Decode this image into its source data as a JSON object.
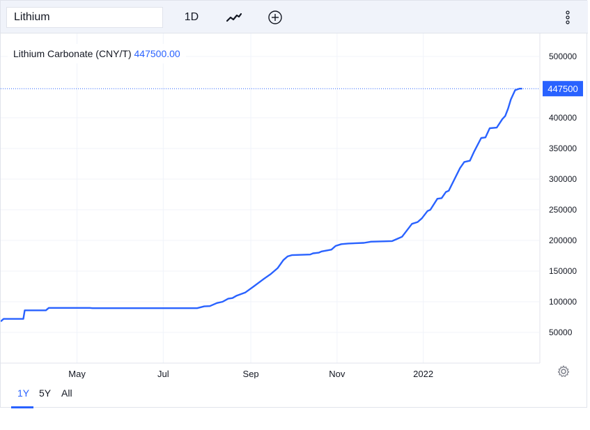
{
  "toolbar": {
    "search_value": "Lithium",
    "interval_label": "1D",
    "chart_style_icon": "line-chart-icon",
    "compare_icon": "plus-circle-icon",
    "more_icon": "vertical-dots-icon"
  },
  "legend": {
    "symbol": "Lithium Carbonate (CNY/T)",
    "value": "447500.00"
  },
  "range_tabs": [
    {
      "label": "1Y",
      "active": true
    },
    {
      "label": "5Y",
      "active": false
    },
    {
      "label": "All",
      "active": false
    }
  ],
  "settings_icon": "gear-icon",
  "colors": {
    "line": "#2962ff",
    "grid": "#f0f3fa",
    "price_label_bg": "#2962ff"
  },
  "chart_data": {
    "type": "line",
    "title": "Lithium Carbonate (CNY/T)",
    "last_value": 447500,
    "y_ticks": [
      50000,
      100000,
      150000,
      200000,
      250000,
      300000,
      350000,
      400000,
      500000
    ],
    "x_ticks": [
      "May",
      "Jul",
      "Sep",
      "Nov",
      "2022"
    ],
    "ylim": [
      0,
      537500
    ],
    "x_range": [
      "2021-03-08",
      "2022-03-24"
    ],
    "grid": true,
    "series": [
      {
        "values": [
          [
            "2021-03-08",
            68000
          ],
          [
            "2021-03-10",
            72000
          ],
          [
            "2021-03-24",
            72000
          ],
          [
            "2021-03-25",
            86000
          ],
          [
            "2021-04-09",
            86000
          ],
          [
            "2021-04-11",
            90000
          ],
          [
            "2021-05-10",
            90000
          ],
          [
            "2021-05-12",
            89500
          ],
          [
            "2021-07-25",
            89500
          ],
          [
            "2021-07-30",
            92500
          ],
          [
            "2021-08-03",
            93000
          ],
          [
            "2021-08-08",
            98000
          ],
          [
            "2021-08-12",
            100000
          ],
          [
            "2021-08-16",
            105000
          ],
          [
            "2021-08-19",
            106000
          ],
          [
            "2021-08-22",
            110000
          ],
          [
            "2021-08-28",
            115000
          ],
          [
            "2021-09-03",
            125000
          ],
          [
            "2021-09-10",
            137000
          ],
          [
            "2021-09-15",
            145000
          ],
          [
            "2021-09-20",
            155000
          ],
          [
            "2021-09-24",
            168000
          ],
          [
            "2021-09-27",
            174000
          ],
          [
            "2021-09-30",
            176000
          ],
          [
            "2021-10-13",
            177000
          ],
          [
            "2021-10-15",
            179000
          ],
          [
            "2021-10-19",
            180000
          ],
          [
            "2021-10-21",
            182000
          ],
          [
            "2021-10-28",
            185000
          ],
          [
            "2021-10-31",
            191000
          ],
          [
            "2021-11-04",
            194000
          ],
          [
            "2021-11-09",
            195000
          ],
          [
            "2021-11-20",
            196000
          ],
          [
            "2021-11-25",
            198000
          ],
          [
            "2021-12-10",
            199000
          ],
          [
            "2021-12-14",
            203000
          ],
          [
            "2021-12-17",
            206000
          ],
          [
            "2021-12-24",
            227000
          ],
          [
            "2021-12-28",
            230000
          ],
          [
            "2021-12-31",
            236000
          ],
          [
            "2022-01-04",
            248000
          ],
          [
            "2022-01-06",
            250000
          ],
          [
            "2022-01-11",
            268000
          ],
          [
            "2022-01-14",
            269000
          ],
          [
            "2022-01-17",
            279000
          ],
          [
            "2022-01-19",
            281000
          ],
          [
            "2022-01-27",
            318000
          ],
          [
            "2022-01-30",
            328000
          ],
          [
            "2022-02-03",
            330000
          ],
          [
            "2022-02-06",
            345000
          ],
          [
            "2022-02-11",
            367000
          ],
          [
            "2022-02-14",
            368000
          ],
          [
            "2022-02-17",
            383000
          ],
          [
            "2022-02-22",
            384000
          ],
          [
            "2022-02-26",
            398000
          ],
          [
            "2022-02-28",
            403000
          ],
          [
            "2022-03-02",
            415000
          ],
          [
            "2022-03-04",
            430000
          ],
          [
            "2022-03-07",
            445000
          ],
          [
            "2022-03-10",
            447500
          ],
          [
            "2022-03-12",
            447500
          ]
        ]
      }
    ]
  }
}
